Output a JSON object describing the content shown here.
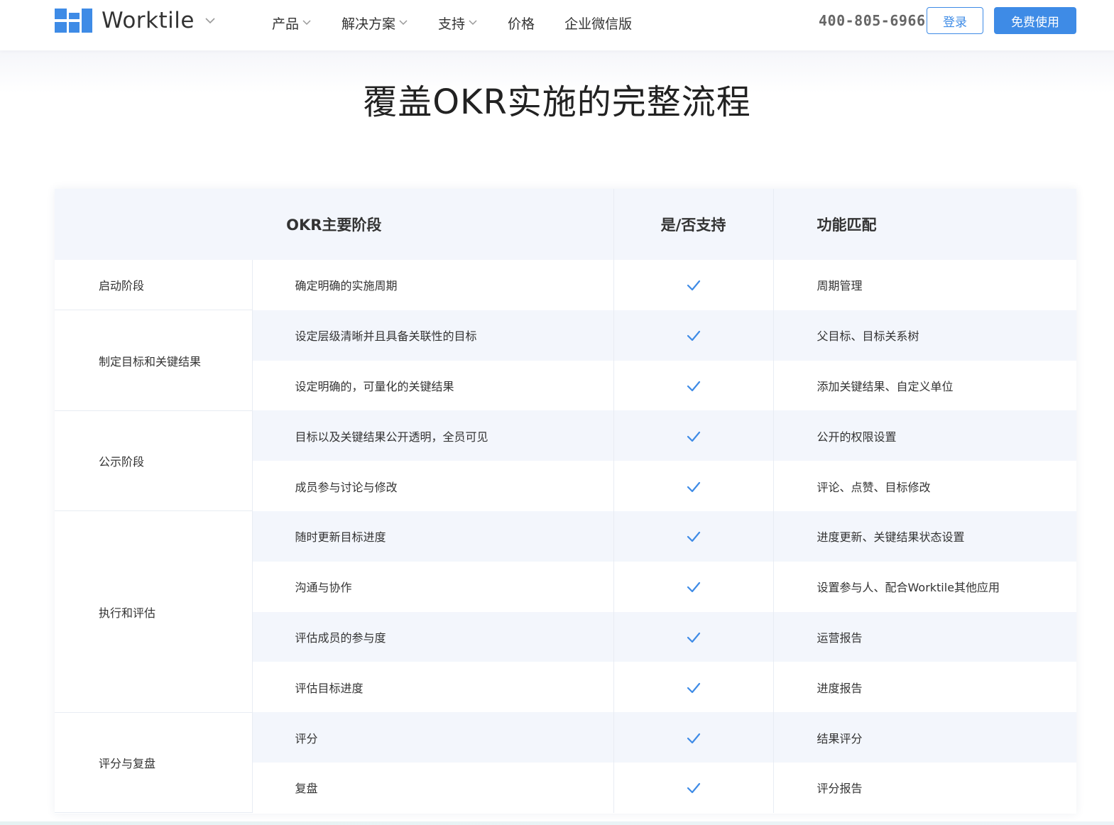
{
  "header": {
    "brand": "Worktile",
    "nav": [
      {
        "label": "产品",
        "has_dropdown": true
      },
      {
        "label": "解决方案",
        "has_dropdown": true
      },
      {
        "label": "支持",
        "has_dropdown": true
      },
      {
        "label": "价格",
        "has_dropdown": false
      },
      {
        "label": "企业微信版",
        "has_dropdown": false
      }
    ],
    "phone": "400-805-6966",
    "login_label": "登录",
    "free_label": "免费使用"
  },
  "colors": {
    "accent": "#3e8be6",
    "header_bg": "#f3f6fc"
  },
  "page_title": "覆盖OKR实施的完整流程",
  "table": {
    "headers": [
      "OKR主要阶段",
      "是/否支持",
      "功能匹配"
    ],
    "rows": [
      {
        "stage": "启动阶段",
        "item": "确定明确的实施周期",
        "supported": true,
        "func": "周期管理"
      },
      {
        "stage": "制定目标和关键结果",
        "item": "设定层级清晰并且具备关联性的目标",
        "supported": true,
        "func": "父目标、目标关系树"
      },
      {
        "stage": "",
        "item": "设定明确的，可量化的关键结果",
        "supported": true,
        "func": "添加关键结果、自定义单位"
      },
      {
        "stage": "公示阶段",
        "item": "目标以及关键结果公开透明，全员可见",
        "supported": true,
        "func": "公开的权限设置"
      },
      {
        "stage": "",
        "item": "成员参与讨论与修改",
        "supported": true,
        "func": "评论、点赞、目标修改"
      },
      {
        "stage": "执行和评估",
        "item": "随时更新目标进度",
        "supported": true,
        "func": "进度更新、关键结果状态设置"
      },
      {
        "stage": "",
        "item": "沟通与协作",
        "supported": true,
        "func": "设置参与人、配合Worktile其他应用"
      },
      {
        "stage": "",
        "item": "评估成员的参与度",
        "supported": true,
        "func": "运营报告"
      },
      {
        "stage": "",
        "item": "评估目标进度",
        "supported": true,
        "func": "进度报告"
      },
      {
        "stage": "评分与复盘",
        "item": "评分",
        "supported": true,
        "func": "结果评分"
      },
      {
        "stage": "",
        "item": "复盘",
        "supported": true,
        "func": "评分报告"
      }
    ],
    "check_icon": "checkmark-icon"
  }
}
